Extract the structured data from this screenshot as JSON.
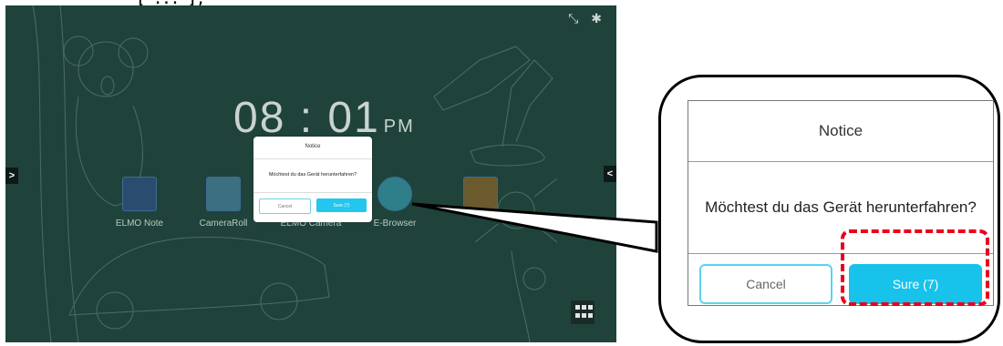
{
  "caption": {
    "text": "[ ... ],"
  },
  "status_bar": {
    "icons": [
      "no-rotation-icon",
      "bluetooth-icon"
    ]
  },
  "clock": {
    "time": "08 : 01",
    "ampm": "PM"
  },
  "apps": [
    {
      "label": "ELMO Note",
      "icon": "note-icon"
    },
    {
      "label": "CameraRoll",
      "icon": "photos-icon"
    },
    {
      "label": "ELMO Camera",
      "icon": "camera-icon"
    },
    {
      "label": "E-Browser",
      "icon": "globe-icon"
    },
    {
      "label": "",
      "icon": "folder-icon"
    }
  ],
  "dialog": {
    "title": "Notice",
    "message": "Möchtest du das Gerät herunterfahren?",
    "cancel_label": "Cancel",
    "sure_label": "Sure (7)"
  },
  "colors": {
    "screen_bg": "#1f433b",
    "accent": "#17c2eb",
    "highlight": "#e8001c"
  }
}
